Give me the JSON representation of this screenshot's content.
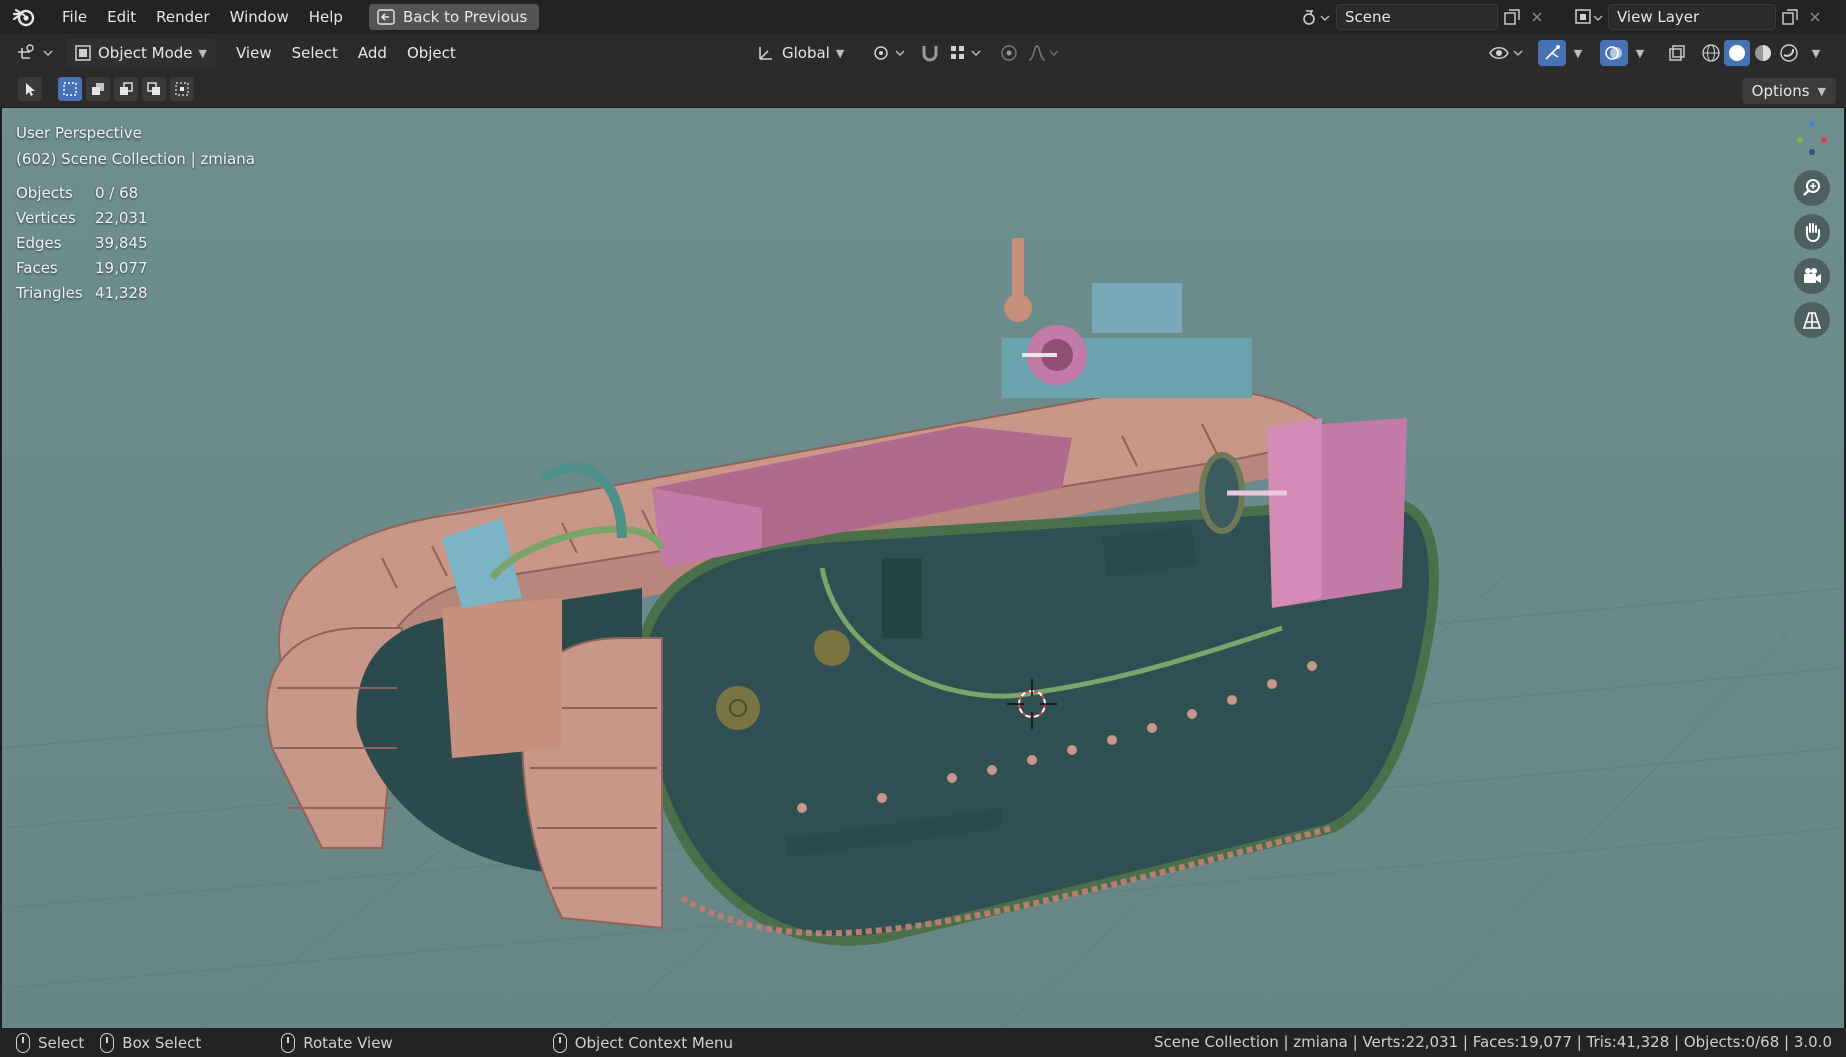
{
  "topbar": {
    "menus": [
      "File",
      "Edit",
      "Render",
      "Window",
      "Help"
    ],
    "back_label": "Back to Previous",
    "scene_name": "Scene",
    "view_layer_name": "View Layer"
  },
  "header": {
    "mode_label": "Object Mode",
    "menus": [
      "View",
      "Select",
      "Add",
      "Object"
    ],
    "orientation_label": "Global"
  },
  "toolrow": {
    "options_label": "Options"
  },
  "viewport": {
    "perspective_label": "User Perspective",
    "collection_label": "(602) Scene Collection | zmiana",
    "stats": [
      {
        "key": "Objects",
        "value": "0 / 68"
      },
      {
        "key": "Vertices",
        "value": "22,031"
      },
      {
        "key": "Edges",
        "value": "39,845"
      },
      {
        "key": "Faces",
        "value": "19,077"
      },
      {
        "key": "Triangles",
        "value": "41,328"
      }
    ],
    "background_color": "#6b8a8b"
  },
  "statusbar": {
    "select_label": "Select",
    "box_select_label": "Box Select",
    "rotate_label": "Rotate View",
    "context_menu_label": "Object Context Menu",
    "summary": "Scene Collection | zmiana | Verts:22,031 | Faces:19,077 | Tris:41,328 | Objects:0/68 | 3.0.0"
  },
  "colors": {
    "accent": "#4772b3",
    "tank_body": "#2f4f52",
    "tracks": "#c9968a",
    "pink_parts": "#c27aa6",
    "pipes": "#7aa56a"
  }
}
